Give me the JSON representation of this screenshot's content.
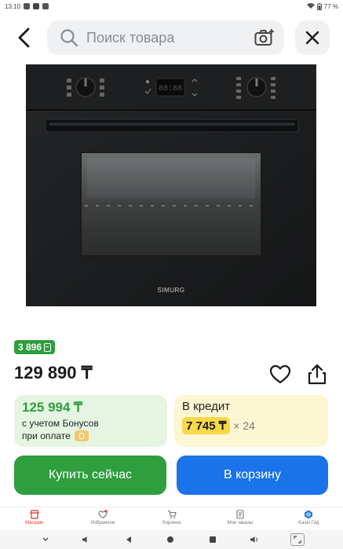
{
  "status_bar": {
    "time": "13:10",
    "battery": "77 %"
  },
  "search": {
    "placeholder": "Поиск товара"
  },
  "product": {
    "brand_on_image": "SIMURG",
    "bonus_badge": "3 896",
    "price": "129 890 ₸"
  },
  "bonus_card": {
    "price": "125 994 ₸",
    "line1": "с учетом Бонусов",
    "line2": "при оплате"
  },
  "credit_card": {
    "title": "В кредит",
    "monthly": "7 745 ₸",
    "months": "× 24"
  },
  "actions": {
    "buy_now": "Купить сейчас",
    "add_to_cart": "В корзину"
  },
  "bottom_nav": {
    "items": [
      {
        "label": "Магазин",
        "icon": "shop-icon"
      },
      {
        "label": "Избранное",
        "icon": "heart-icon"
      },
      {
        "label": "Корзина",
        "icon": "cart-icon"
      },
      {
        "label": "Мои заказы",
        "icon": "orders-icon"
      },
      {
        "label": "Kaspi Гид",
        "icon": "guide-icon"
      }
    ]
  },
  "colors": {
    "green": "#2e9e3f",
    "blue": "#1a73e8",
    "yellow": "#f7d94a",
    "accent_red": "#e0342b"
  }
}
